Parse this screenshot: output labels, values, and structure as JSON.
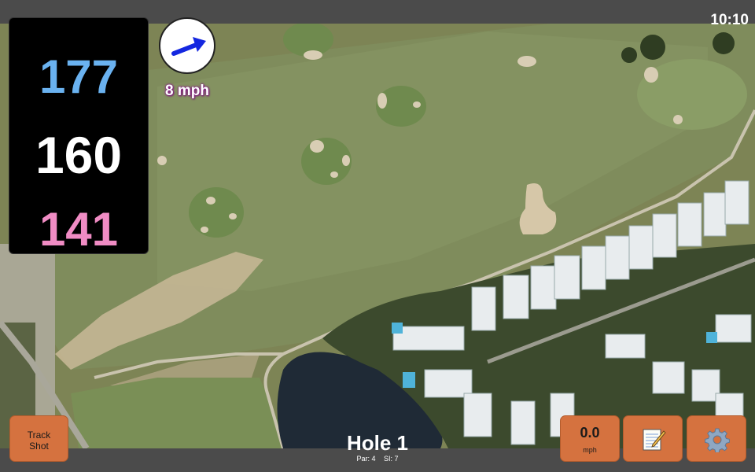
{
  "status": {
    "time": "10:10"
  },
  "distances": {
    "back": "177",
    "center": "160",
    "front": "141"
  },
  "wind": {
    "speed_label": "8 mph",
    "icon": "arrow-icon",
    "direction": "northeast"
  },
  "hole": {
    "title": "Hole 1",
    "par": "Par: 4",
    "stroke_index": "SI: 7"
  },
  "buttons": {
    "track_shot": "Track\nShot",
    "speed_value": "0.0",
    "speed_unit": "mph",
    "notes_icon": "notepad-icon",
    "settings_icon": "gear-icon"
  },
  "colors": {
    "back_distance": "#6ab2f0",
    "center_distance": "#ffffff",
    "front_distance": "#f08cc4",
    "button": "#d5723f",
    "wind_label_outline": "#8a1f8a"
  }
}
